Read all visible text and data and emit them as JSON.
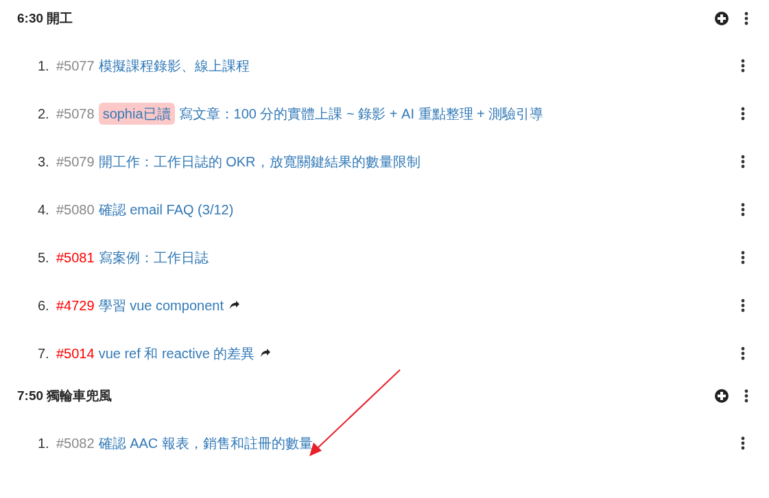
{
  "sections": [
    {
      "title": "6:30 開工",
      "items": [
        {
          "number": "1.",
          "id": "#5077",
          "overdue": false,
          "title": "模擬課程錄影、線上課程",
          "linked": false
        },
        {
          "number": "2.",
          "id": "#5078",
          "overdue": false,
          "tag": "sophia已讀",
          "title": "寫文章：100 分的實體上課 ~ 錄影 + AI 重點整理 + 測驗引導",
          "linked": false
        },
        {
          "number": "3.",
          "id": "#5079",
          "overdue": false,
          "title": "開工作：工作日誌的 OKR，放寬關鍵結果的數量限制",
          "linked": false
        },
        {
          "number": "4.",
          "id": "#5080",
          "overdue": false,
          "title": "確認 email FAQ (3/12)",
          "linked": false
        },
        {
          "number": "5.",
          "id": "#5081",
          "overdue": true,
          "title": "寫案例：工作日誌",
          "linked": false
        },
        {
          "number": "6.",
          "id": "#4729",
          "overdue": true,
          "title": "學習 vue component",
          "linked": true
        },
        {
          "number": "7.",
          "id": "#5014",
          "overdue": true,
          "title": "vue ref 和 reactive 的差異",
          "linked": true
        }
      ]
    },
    {
      "title": "7:50 獨輪車兜風",
      "items": [
        {
          "number": "1.",
          "id": "#5082",
          "overdue": false,
          "title": "確認 AAC 報表，銷售和註冊的數量",
          "linked": false
        }
      ]
    }
  ]
}
